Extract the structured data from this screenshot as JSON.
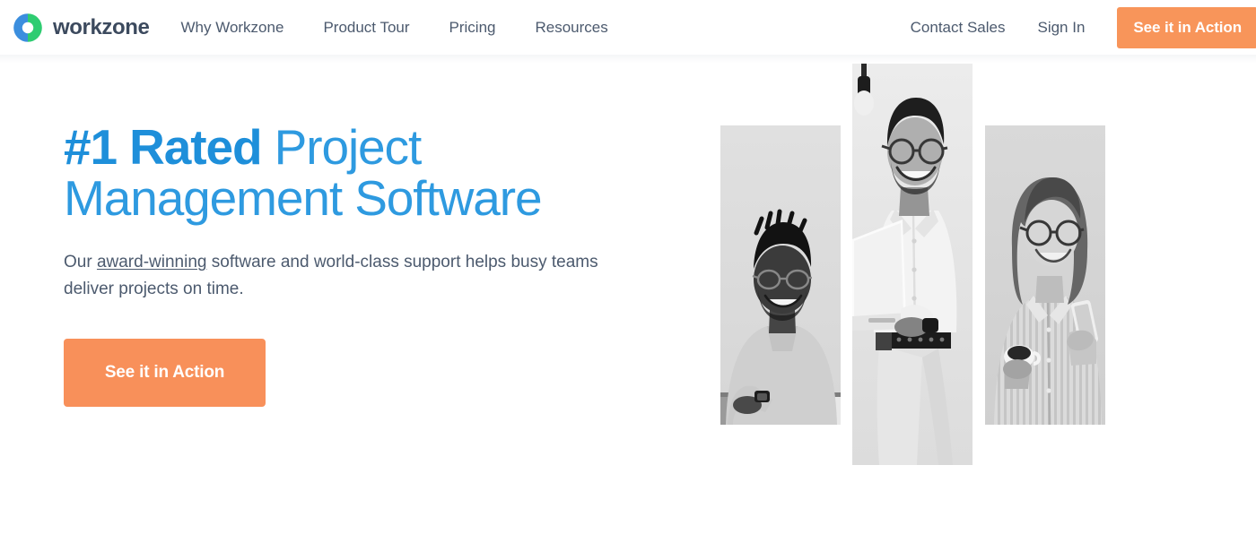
{
  "brand": {
    "name": "workzone",
    "logo_colors": {
      "blue": "#3b8ede",
      "green": "#2ecc71"
    }
  },
  "header": {
    "nav_items": [
      {
        "label": "Why Workzone",
        "name": "nav-why-workzone"
      },
      {
        "label": "Product Tour",
        "name": "nav-product-tour"
      },
      {
        "label": "Pricing",
        "name": "nav-pricing"
      },
      {
        "label": "Resources",
        "name": "nav-resources"
      }
    ],
    "contact_sales_label": "Contact Sales",
    "sign_in_label": "Sign In",
    "cta_label": "See it in Action",
    "cta_color": "#f8955a",
    "text_color": "#4c5a6e"
  },
  "hero": {
    "title_strong": "#1 Rated",
    "title_rest": " Project Management Software",
    "title_color": "#2e9ae0",
    "subtitle_prefix": "Our ",
    "subtitle_link": "award-winning",
    "subtitle_rest": " software and world-class support helps busy teams deliver projects on time.",
    "cta_label": "See it in Action",
    "cta_color": "#f8905a",
    "images": [
      {
        "name": "photo-man-laptop-left",
        "alt": "Man with glasses smiling at desk"
      },
      {
        "name": "photo-man-standing-center",
        "alt": "Man with glasses holding an open laptop"
      },
      {
        "name": "photo-woman-phone-right",
        "alt": "Woman with glasses holding phone and mug"
      }
    ]
  }
}
